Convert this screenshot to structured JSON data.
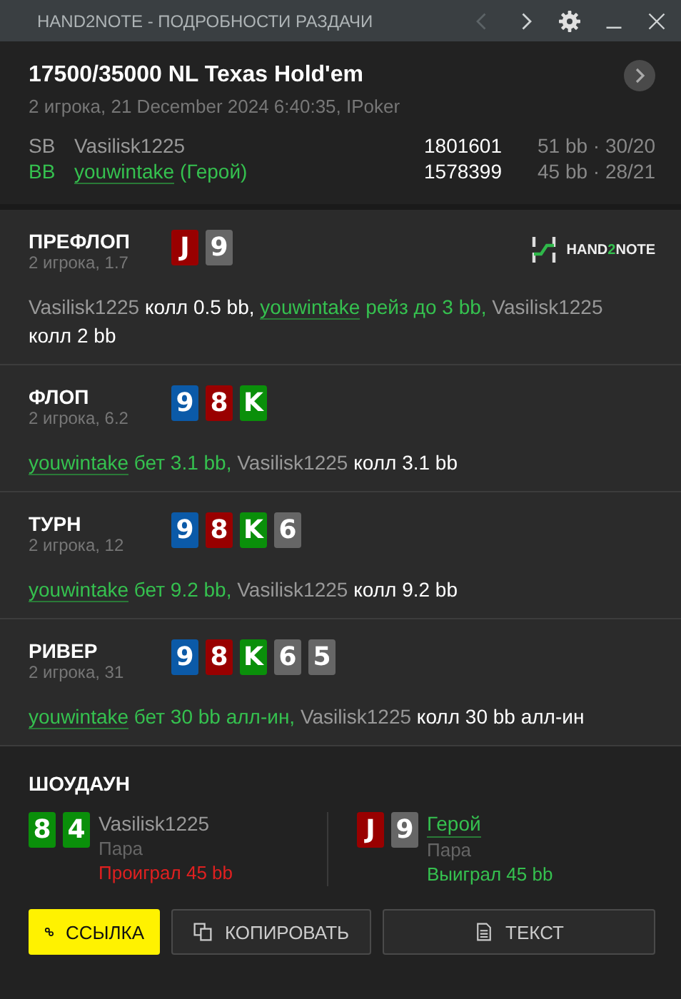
{
  "window": {
    "title": "HAND2NOTE - ПОДРОБНОСТИ РАЗДАЧИ",
    "nav": [
      {
        "kind": "prev",
        "disabled": true
      },
      {
        "kind": "next",
        "disabled": false
      }
    ]
  },
  "hand": {
    "title": "17500/35000 NL Texas Hold'em",
    "subtitle": "2 игрока, 21 December 2024 6:40:35, IPoker",
    "players": [
      {
        "position": "SB",
        "name": "Vasilisk1225",
        "hero": false,
        "stack": "1801601",
        "stats": "51 bb · 30/20"
      },
      {
        "position": "BB",
        "name": "youwintake",
        "hero": true,
        "hero_tag": "(Герой)",
        "stack": "1578399",
        "stats": "45 bb · 28/21"
      }
    ]
  },
  "logo": {
    "pre": "HAND",
    "mid": "2",
    "post": "NOTE"
  },
  "streets": [
    {
      "name": "ПРЕФЛОП",
      "info": "2 игрока, 1.7",
      "cards": [
        {
          "rank": "J",
          "color": "#990000"
        },
        {
          "rank": "9",
          "color": "#666666"
        }
      ],
      "actions": [
        {
          "player": "Vasilisk1225",
          "hero": false,
          "text": "колл 0.5 bb,"
        },
        {
          "player": "youwintake",
          "hero": true,
          "text": "рейз до 3 bb,"
        },
        {
          "player": "Vasilisk1225",
          "hero": false,
          "text": "колл 2 bb"
        }
      ]
    },
    {
      "name": "ФЛОП",
      "info": "2 игрока, 6.2",
      "cards": [
        {
          "rank": "9",
          "color": "#0b5aa8"
        },
        {
          "rank": "8",
          "color": "#990000"
        },
        {
          "rank": "K",
          "color": "#0a8f0a"
        }
      ],
      "actions": [
        {
          "player": "youwintake",
          "hero": true,
          "text": "бет 3.1 bb,"
        },
        {
          "player": "Vasilisk1225",
          "hero": false,
          "text": "колл 3.1 bb"
        }
      ]
    },
    {
      "name": "ТУРН",
      "info": "2 игрока, 12",
      "cards": [
        {
          "rank": "9",
          "color": "#0b5aa8"
        },
        {
          "rank": "8",
          "color": "#990000"
        },
        {
          "rank": "K",
          "color": "#0a8f0a"
        },
        {
          "rank": "6",
          "color": "#666666"
        }
      ],
      "actions": [
        {
          "player": "youwintake",
          "hero": true,
          "text": "бет 9.2 bb,"
        },
        {
          "player": "Vasilisk1225",
          "hero": false,
          "text": "колл 9.2 bb"
        }
      ]
    },
    {
      "name": "РИВЕР",
      "info": "2 игрока, 31",
      "cards": [
        {
          "rank": "9",
          "color": "#0b5aa8"
        },
        {
          "rank": "8",
          "color": "#990000"
        },
        {
          "rank": "K",
          "color": "#0a8f0a"
        },
        {
          "rank": "6",
          "color": "#666666"
        },
        {
          "rank": "5",
          "color": "#666666"
        }
      ],
      "actions": [
        {
          "player": "youwintake",
          "hero": true,
          "text": "бет 30 bb алл-ин,"
        },
        {
          "player": "Vasilisk1225",
          "hero": false,
          "text": "колл 30 bb алл-ин"
        }
      ]
    }
  ],
  "showdown": {
    "title": "ШОУДАУН",
    "players": [
      {
        "name": "Vasilisk1225",
        "hero": false,
        "hand": "Пара",
        "result": "Проиграл 45 bb",
        "won": false,
        "cards": [
          {
            "rank": "8",
            "color": "#0a8f0a"
          },
          {
            "rank": "4",
            "color": "#0a8f0a"
          }
        ]
      },
      {
        "name": "Герой",
        "hero": true,
        "hand": "Пара",
        "result": "Выиграл 45 bb",
        "won": true,
        "cards": [
          {
            "rank": "J",
            "color": "#990000"
          },
          {
            "rank": "9",
            "color": "#666666"
          }
        ]
      }
    ]
  },
  "buttons": [
    {
      "kind": "link",
      "label": "ССЫЛКА",
      "primary": true
    },
    {
      "kind": "copy",
      "label": "КОПИРОВАТЬ",
      "primary": false
    },
    {
      "kind": "text",
      "label": "ТЕКСТ",
      "primary": false
    }
  ]
}
